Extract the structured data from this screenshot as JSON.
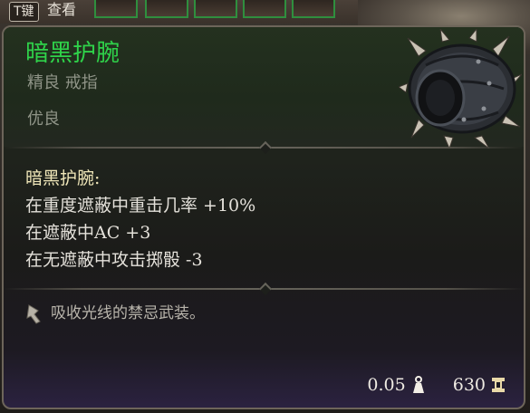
{
  "hotbar": {
    "key_hint": "T键",
    "look_label": "查看"
  },
  "item": {
    "name": "暗黑护腕",
    "type_line": "精良 戒指",
    "rarity": "优良",
    "name_color": "#2fd24a",
    "image_icon": "spiked-bracer-icon"
  },
  "effects": {
    "title": "暗黑护腕:",
    "lines": [
      "在重度遮蔽中重击几率 +10%",
      "在遮蔽中AC +3",
      "在无遮蔽中攻击掷骰 -3"
    ]
  },
  "lore": {
    "icon": "quill-icon",
    "text": "吸收光线的禁忌武装。"
  },
  "footer": {
    "weight": "0.05",
    "weight_icon": "weight-icon",
    "value": "630",
    "value_icon": "gold-icon"
  }
}
